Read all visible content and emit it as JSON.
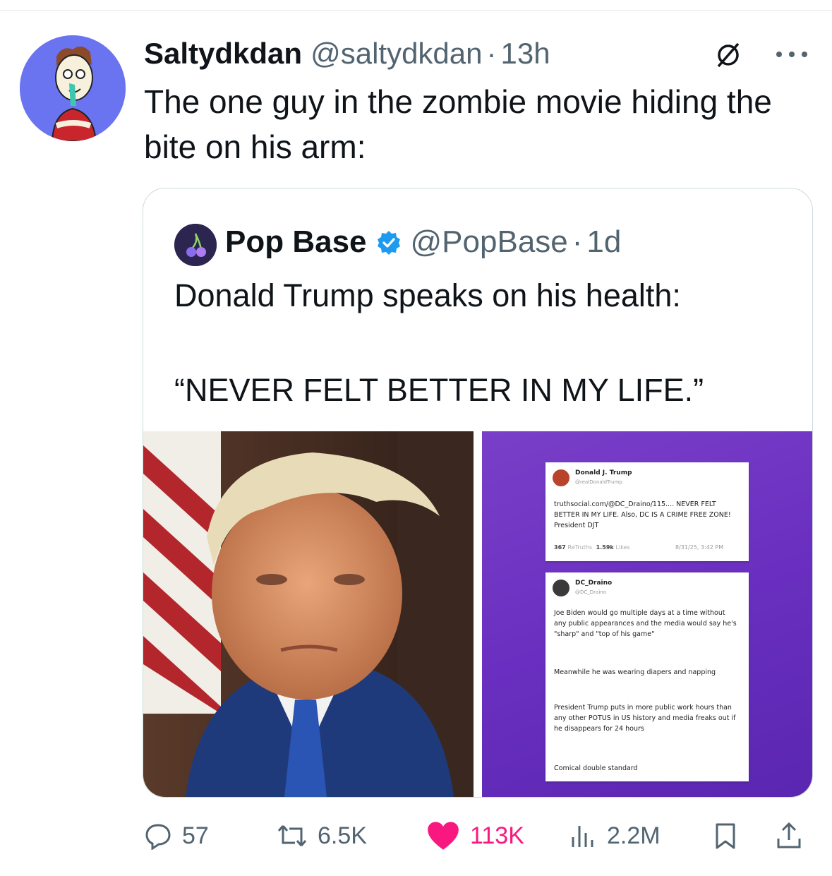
{
  "post": {
    "author_name": "Saltydkdan",
    "author_handle": "@saltydkdan",
    "separator": "·",
    "time": "13h",
    "text": "The one guy in the zombie movie hiding the bite on his arm:",
    "icons": {
      "grok": "grok-icon",
      "more": "more-icon"
    }
  },
  "quote": {
    "author_name": "Pop Base",
    "author_handle": "@PopBase",
    "separator": "·",
    "time": "1d",
    "verified": true,
    "text_line1": "Donald Trump speaks on his health:",
    "text_line2": "“NEVER FELT BETTER IN MY LIFE.”",
    "screenshot": {
      "card1": {
        "name": "Donald J. Trump",
        "handle": "@realDonaldTrump",
        "text": "truthsocial.com/@DC_Draino/115.... NEVER FELT BETTER IN MY LIFE. Also, DC IS A CRIME FREE ZONE! President DJT",
        "retruths_count": "367",
        "retruths_label": "ReTruths",
        "likes_count": "1.59k",
        "likes_label": "Likes",
        "timestamp": "8/31/25, 3:42 PM"
      },
      "card2": {
        "name": "DC_Draino",
        "handle": "@DC_Draino",
        "p1": "Joe Biden would go multiple days at a time without any public appearances and the media would say he's \"sharp\" and \"top of his game\"",
        "p2": "Meanwhile he was wearing diapers and napping",
        "p3": "President Trump puts in more public work hours than any other POTUS in US history and media freaks out if he disappears for 24 hours",
        "p4": "Comical double standard"
      }
    }
  },
  "actions": {
    "replies": "57",
    "reposts": "6.5K",
    "likes": "113K",
    "views": "2.2M",
    "colors": {
      "like": "#f91880",
      "muted": "#536471",
      "verified": "#1d9bf0"
    }
  }
}
